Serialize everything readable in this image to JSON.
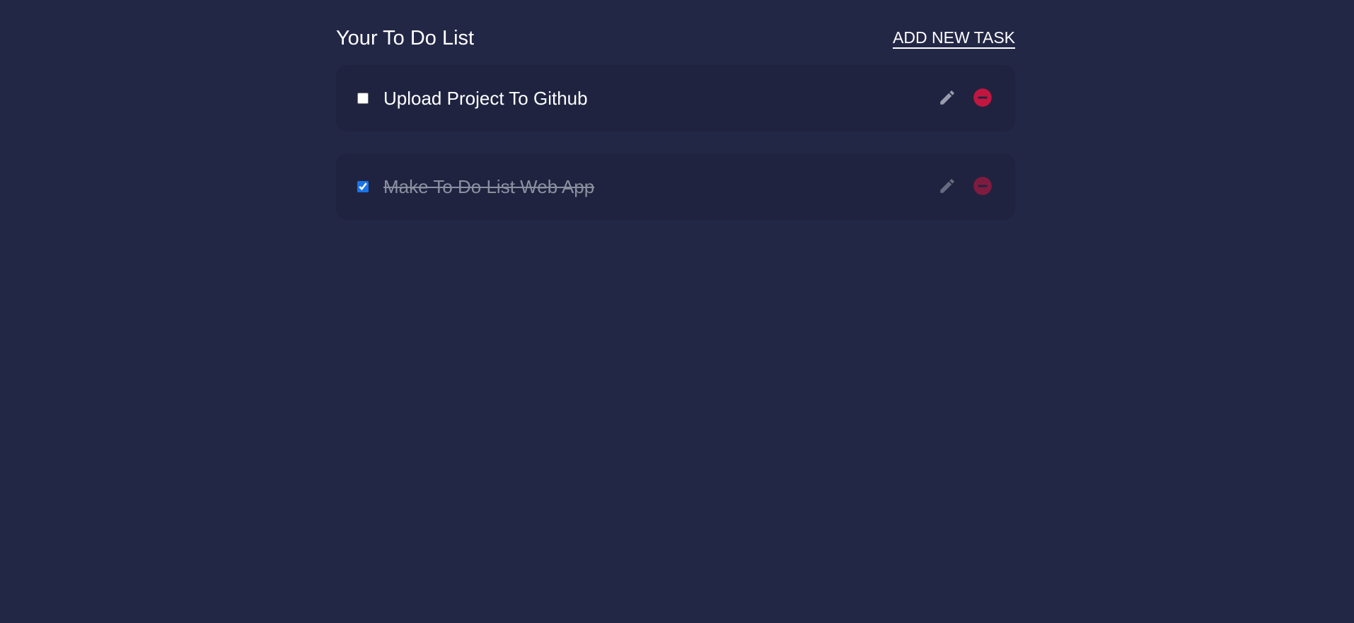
{
  "header": {
    "title": "Your To Do List",
    "add_task_label": "ADD NEW TASK"
  },
  "colors": {
    "background": "#232746",
    "card": "#1f2340",
    "edit_icon": "#9a9cab",
    "delete_icon": "#c0163f",
    "checkbox_accent": "#1a73e8"
  },
  "tasks": [
    {
      "label": "Upload Project To Github",
      "completed": false,
      "edit_icon": "pencil-icon",
      "delete_icon": "minus-circle-icon"
    },
    {
      "label": "Make To Do List Web App",
      "completed": true,
      "edit_icon": "pencil-icon",
      "delete_icon": "minus-circle-icon"
    }
  ]
}
